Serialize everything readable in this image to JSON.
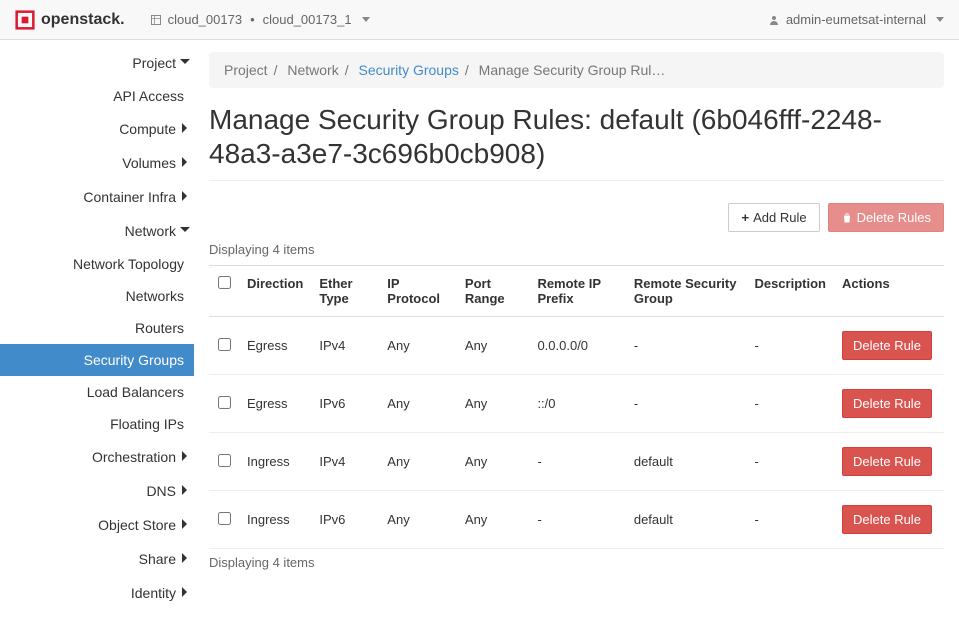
{
  "brand": "openstack.",
  "context": {
    "region": "cloud_00173",
    "project": "cloud_00173_1"
  },
  "user": "admin-eumetsat-internal",
  "nav": {
    "project": "Project",
    "api_access": "API Access",
    "compute": "Compute",
    "volumes": "Volumes",
    "container_infra": "Container Infra",
    "network": "Network",
    "network_topology": "Network Topology",
    "networks": "Networks",
    "routers": "Routers",
    "security_groups": "Security Groups",
    "load_balancers": "Load Balancers",
    "floating_ips": "Floating IPs",
    "orchestration": "Orchestration",
    "dns": "DNS",
    "object_store": "Object Store",
    "share": "Share",
    "identity": "Identity"
  },
  "breadcrumb": {
    "project": "Project",
    "network": "Network",
    "security_groups": "Security Groups",
    "current": "Manage Security Group Rul…"
  },
  "page_title": "Manage Security Group Rules: default (6b046fff-2248-48a3-a3e7-3c696b0cb908)",
  "buttons": {
    "add_rule": "Add Rule",
    "delete_rules": "Delete Rules",
    "delete_rule": "Delete Rule"
  },
  "count_label_top": "Displaying 4 items",
  "count_label_bottom": "Displaying 4 items",
  "columns": {
    "direction": "Direction",
    "ether_type": "Ether Type",
    "ip_protocol": "IP Protocol",
    "port_range": "Port Range",
    "remote_ip": "Remote IP Prefix",
    "remote_sg": "Remote Security Group",
    "description": "Description",
    "actions": "Actions"
  },
  "rows": [
    {
      "direction": "Egress",
      "ether_type": "IPv4",
      "ip_protocol": "Any",
      "port_range": "Any",
      "remote_ip": "0.0.0.0/0",
      "remote_sg": "-",
      "description": "-"
    },
    {
      "direction": "Egress",
      "ether_type": "IPv6",
      "ip_protocol": "Any",
      "port_range": "Any",
      "remote_ip": "::/0",
      "remote_sg": "-",
      "description": "-"
    },
    {
      "direction": "Ingress",
      "ether_type": "IPv4",
      "ip_protocol": "Any",
      "port_range": "Any",
      "remote_ip": "-",
      "remote_sg": "default",
      "description": "-"
    },
    {
      "direction": "Ingress",
      "ether_type": "IPv6",
      "ip_protocol": "Any",
      "port_range": "Any",
      "remote_ip": "-",
      "remote_sg": "default",
      "description": "-"
    }
  ]
}
